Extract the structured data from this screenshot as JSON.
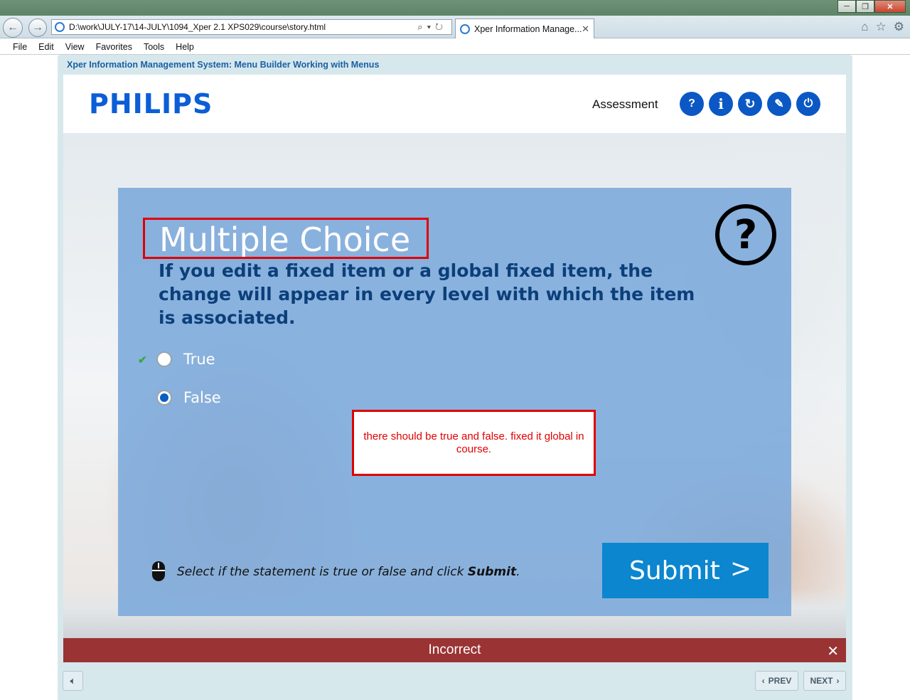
{
  "browser": {
    "address": "D:\\work\\JULY-17\\14-JULY\\1094_Xper 2.1 XPS029\\course\\story.html",
    "tab_title": "Xper Information Manage...",
    "menu": [
      "File",
      "Edit",
      "View",
      "Favorites",
      "Tools",
      "Help"
    ]
  },
  "course": {
    "title": "Xper Information Management System: Menu Builder Working with Menus",
    "logo": "PHILIPS",
    "section_label": "Assessment",
    "header_buttons": [
      "help",
      "info",
      "replay",
      "pen",
      "power"
    ]
  },
  "question": {
    "type_title": "Multiple Choice",
    "text": "If you edit a fixed item or a global fixed item, the change will appear in every level with which the item is associated.",
    "options": [
      {
        "label": "True",
        "selected": false,
        "correct": true
      },
      {
        "label": "False",
        "selected": true,
        "correct": false
      }
    ],
    "instruction_pre": "Select if the statement is true or false and click ",
    "instruction_bold": "Submit",
    "instruction_post": ".",
    "submit_label": "Submit",
    "submit_arrow": ">"
  },
  "review_note": "there should be true and false. fixed it global in course.",
  "feedback": {
    "label": "Incorrect",
    "close": "✕"
  },
  "footer": {
    "prev": "PREV",
    "next": "NEXT"
  },
  "colors": {
    "accent": "#0b58c4",
    "feedback_bar": "#9a3333",
    "annotation": "#e00000"
  }
}
